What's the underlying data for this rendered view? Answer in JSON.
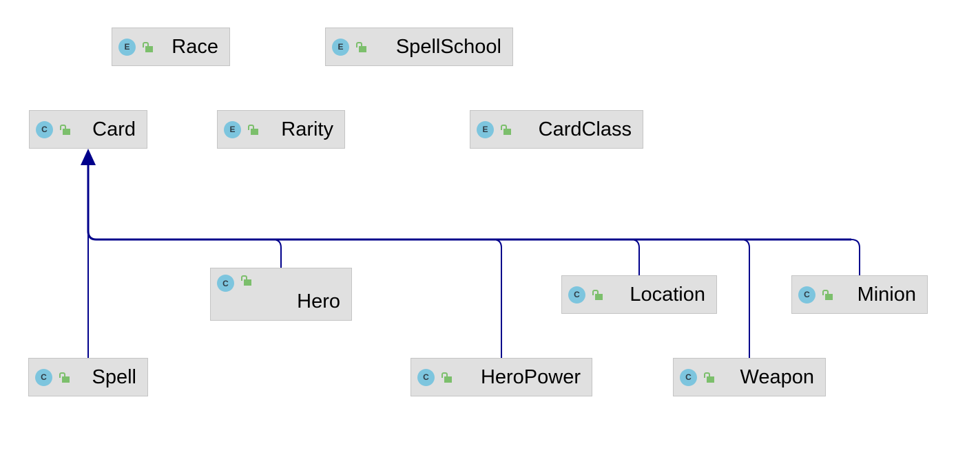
{
  "diagram": {
    "nodes": [
      {
        "id": "race",
        "label": "Race",
        "kind": "E",
        "visibility": "public"
      },
      {
        "id": "spellschool",
        "label": "SpellSchool",
        "kind": "E",
        "visibility": "public"
      },
      {
        "id": "card",
        "label": "Card",
        "kind": "C",
        "visibility": "public"
      },
      {
        "id": "rarity",
        "label": "Rarity",
        "kind": "E",
        "visibility": "public"
      },
      {
        "id": "cardclass",
        "label": "CardClass",
        "kind": "E",
        "visibility": "public"
      },
      {
        "id": "hero",
        "label": "Hero",
        "kind": "C",
        "visibility": "public"
      },
      {
        "id": "location",
        "label": "Location",
        "kind": "C",
        "visibility": "public"
      },
      {
        "id": "minion",
        "label": "Minion",
        "kind": "C",
        "visibility": "public"
      },
      {
        "id": "spell",
        "label": "Spell",
        "kind": "C",
        "visibility": "public"
      },
      {
        "id": "heropower",
        "label": "HeroPower",
        "kind": "C",
        "visibility": "public"
      },
      {
        "id": "weapon",
        "label": "Weapon",
        "kind": "C",
        "visibility": "public"
      }
    ],
    "edges": [
      {
        "from": "Spell",
        "to": "Card",
        "type": "extends"
      },
      {
        "from": "Hero",
        "to": "Card",
        "type": "extends"
      },
      {
        "from": "HeroPower",
        "to": "Card",
        "type": "extends"
      },
      {
        "from": "Location",
        "to": "Card",
        "type": "extends"
      },
      {
        "from": "Weapon",
        "to": "Card",
        "type": "extends"
      },
      {
        "from": "Minion",
        "to": "Card",
        "type": "extends"
      }
    ],
    "colors": {
      "edge": "#00008b",
      "node_bg": "#e0e0e0",
      "kind_icon": "#7dc5de",
      "lock_icon": "#7cbf6c"
    }
  }
}
